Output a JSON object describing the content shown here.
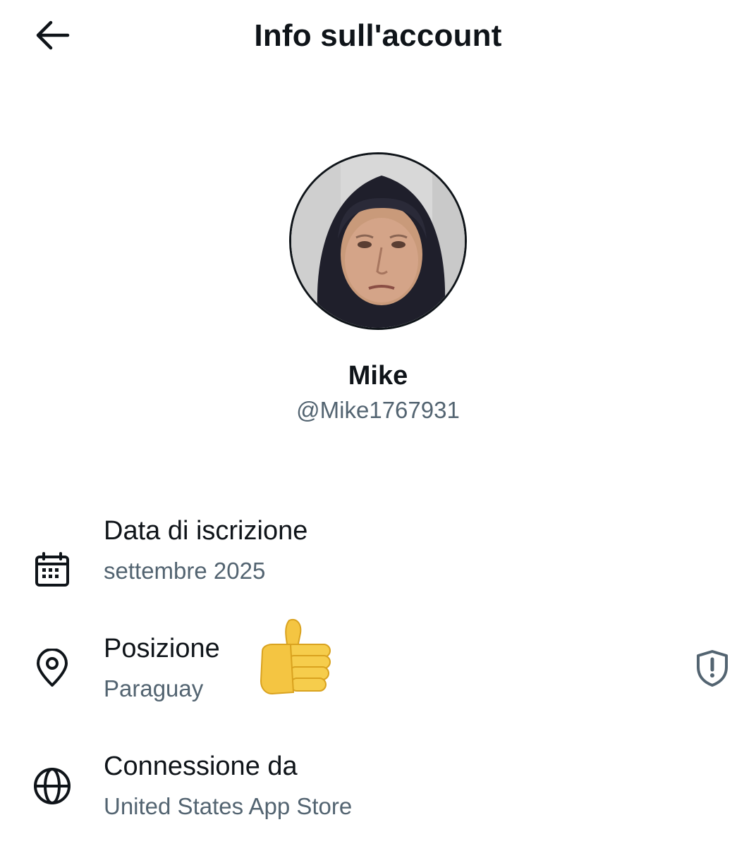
{
  "header": {
    "title": "Info sull'account",
    "back_icon": "arrow-left-icon"
  },
  "profile": {
    "display_name": "Mike",
    "handle": "@Mike1767931",
    "avatar_icon": "profile-photo"
  },
  "info": {
    "join_date": {
      "label": "Data di iscrizione",
      "value": "settembre 2025",
      "icon": "calendar-icon"
    },
    "location": {
      "label": "Posizione",
      "value": "Paraguay",
      "icon": "location-pin-icon",
      "annotation_icon": "thumbs-up-emoji",
      "badge_icon": "shield-alert-icon"
    },
    "connection": {
      "label": "Connessione da",
      "value": "United States App Store",
      "icon": "globe-icon"
    }
  },
  "colors": {
    "text_primary": "#0f1419",
    "text_secondary": "#536471",
    "background": "#ffffff"
  }
}
